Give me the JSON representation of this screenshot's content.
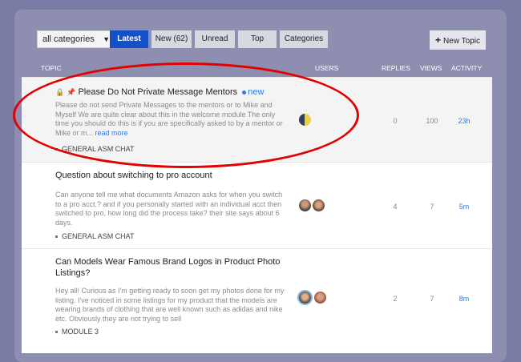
{
  "nav": {
    "category_select": "all categories",
    "tabs": [
      {
        "label": "Latest",
        "active": true
      },
      {
        "label": "New (62)"
      },
      {
        "label": "Unread"
      },
      {
        "label": "Top"
      },
      {
        "label": "Categories"
      }
    ],
    "new_topic": "New Topic"
  },
  "headers": {
    "topic": "TOPIC",
    "users": "USERS",
    "replies": "REPLIES",
    "views": "VIEWS",
    "activity": "ACTIVITY"
  },
  "topics": [
    {
      "title": "Please Do Not Private Message Mentors",
      "badge": "new",
      "excerpt": "Please do not send Private Messages to the mentors or to Mike and Myself We are quite clear about this in the welcome module The only time you should do this is if you are specifically asked to by a mentor or Mike or m...",
      "read_more": "read more",
      "category": "GENERAL ASM CHAT",
      "replies": "0",
      "views": "100",
      "activity": "23h"
    },
    {
      "title": "Question about switching to pro account",
      "excerpt": "Can anyone tell me what documents Amazon asks for when you switch to a pro acct.? and if you personally started with an individual acct then switched to pro, how long did the process take? their site says about 6 days.",
      "category": "GENERAL ASM CHAT",
      "replies": "4",
      "views": "7",
      "activity": "5m"
    },
    {
      "title": "Can Models Wear Famous Brand Logos in Product Photo Listings?",
      "excerpt": "Hey all! Curious as I'm getting ready to soon get my photos done for my listing. I've noticed in some listings for my product that the models are wearing brands of clothing that are well known such as adidas and nike etc. Obviously they are not trying to sell",
      "category": "MODULE 3",
      "replies": "2",
      "views": "7",
      "activity": "8m"
    }
  ],
  "colors": {
    "accent": "#1450c8",
    "link": "#2d7ae0",
    "annotation": "#e30000"
  }
}
